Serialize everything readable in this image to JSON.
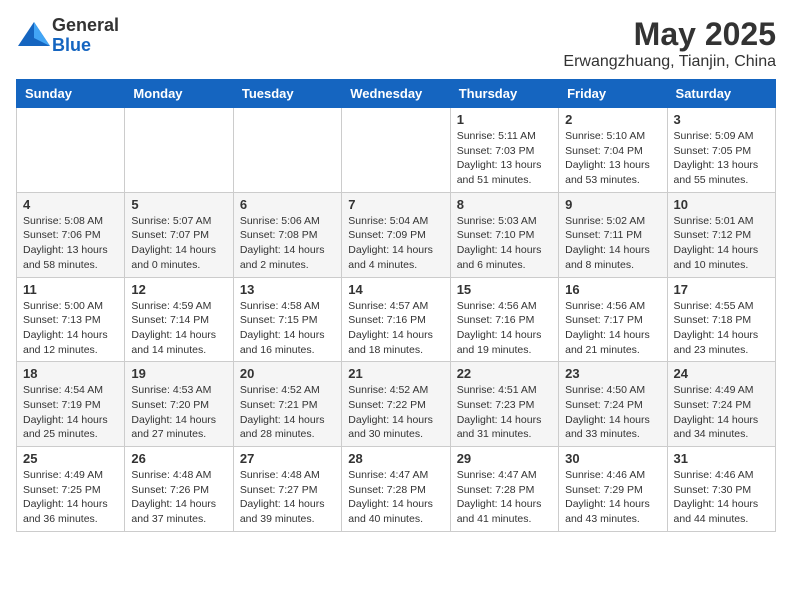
{
  "logo": {
    "general": "General",
    "blue": "Blue"
  },
  "title": "May 2025",
  "location": "Erwangzhuang, Tianjin, China",
  "headers": [
    "Sunday",
    "Monday",
    "Tuesday",
    "Wednesday",
    "Thursday",
    "Friday",
    "Saturday"
  ],
  "weeks": [
    [
      {
        "day": "",
        "info": ""
      },
      {
        "day": "",
        "info": ""
      },
      {
        "day": "",
        "info": ""
      },
      {
        "day": "",
        "info": ""
      },
      {
        "day": "1",
        "info": "Sunrise: 5:11 AM\nSunset: 7:03 PM\nDaylight: 13 hours\nand 51 minutes."
      },
      {
        "day": "2",
        "info": "Sunrise: 5:10 AM\nSunset: 7:04 PM\nDaylight: 13 hours\nand 53 minutes."
      },
      {
        "day": "3",
        "info": "Sunrise: 5:09 AM\nSunset: 7:05 PM\nDaylight: 13 hours\nand 55 minutes."
      }
    ],
    [
      {
        "day": "4",
        "info": "Sunrise: 5:08 AM\nSunset: 7:06 PM\nDaylight: 13 hours\nand 58 minutes."
      },
      {
        "day": "5",
        "info": "Sunrise: 5:07 AM\nSunset: 7:07 PM\nDaylight: 14 hours\nand 0 minutes."
      },
      {
        "day": "6",
        "info": "Sunrise: 5:06 AM\nSunset: 7:08 PM\nDaylight: 14 hours\nand 2 minutes."
      },
      {
        "day": "7",
        "info": "Sunrise: 5:04 AM\nSunset: 7:09 PM\nDaylight: 14 hours\nand 4 minutes."
      },
      {
        "day": "8",
        "info": "Sunrise: 5:03 AM\nSunset: 7:10 PM\nDaylight: 14 hours\nand 6 minutes."
      },
      {
        "day": "9",
        "info": "Sunrise: 5:02 AM\nSunset: 7:11 PM\nDaylight: 14 hours\nand 8 minutes."
      },
      {
        "day": "10",
        "info": "Sunrise: 5:01 AM\nSunset: 7:12 PM\nDaylight: 14 hours\nand 10 minutes."
      }
    ],
    [
      {
        "day": "11",
        "info": "Sunrise: 5:00 AM\nSunset: 7:13 PM\nDaylight: 14 hours\nand 12 minutes."
      },
      {
        "day": "12",
        "info": "Sunrise: 4:59 AM\nSunset: 7:14 PM\nDaylight: 14 hours\nand 14 minutes."
      },
      {
        "day": "13",
        "info": "Sunrise: 4:58 AM\nSunset: 7:15 PM\nDaylight: 14 hours\nand 16 minutes."
      },
      {
        "day": "14",
        "info": "Sunrise: 4:57 AM\nSunset: 7:16 PM\nDaylight: 14 hours\nand 18 minutes."
      },
      {
        "day": "15",
        "info": "Sunrise: 4:56 AM\nSunset: 7:16 PM\nDaylight: 14 hours\nand 19 minutes."
      },
      {
        "day": "16",
        "info": "Sunrise: 4:56 AM\nSunset: 7:17 PM\nDaylight: 14 hours\nand 21 minutes."
      },
      {
        "day": "17",
        "info": "Sunrise: 4:55 AM\nSunset: 7:18 PM\nDaylight: 14 hours\nand 23 minutes."
      }
    ],
    [
      {
        "day": "18",
        "info": "Sunrise: 4:54 AM\nSunset: 7:19 PM\nDaylight: 14 hours\nand 25 minutes."
      },
      {
        "day": "19",
        "info": "Sunrise: 4:53 AM\nSunset: 7:20 PM\nDaylight: 14 hours\nand 27 minutes."
      },
      {
        "day": "20",
        "info": "Sunrise: 4:52 AM\nSunset: 7:21 PM\nDaylight: 14 hours\nand 28 minutes."
      },
      {
        "day": "21",
        "info": "Sunrise: 4:52 AM\nSunset: 7:22 PM\nDaylight: 14 hours\nand 30 minutes."
      },
      {
        "day": "22",
        "info": "Sunrise: 4:51 AM\nSunset: 7:23 PM\nDaylight: 14 hours\nand 31 minutes."
      },
      {
        "day": "23",
        "info": "Sunrise: 4:50 AM\nSunset: 7:24 PM\nDaylight: 14 hours\nand 33 minutes."
      },
      {
        "day": "24",
        "info": "Sunrise: 4:49 AM\nSunset: 7:24 PM\nDaylight: 14 hours\nand 34 minutes."
      }
    ],
    [
      {
        "day": "25",
        "info": "Sunrise: 4:49 AM\nSunset: 7:25 PM\nDaylight: 14 hours\nand 36 minutes."
      },
      {
        "day": "26",
        "info": "Sunrise: 4:48 AM\nSunset: 7:26 PM\nDaylight: 14 hours\nand 37 minutes."
      },
      {
        "day": "27",
        "info": "Sunrise: 4:48 AM\nSunset: 7:27 PM\nDaylight: 14 hours\nand 39 minutes."
      },
      {
        "day": "28",
        "info": "Sunrise: 4:47 AM\nSunset: 7:28 PM\nDaylight: 14 hours\nand 40 minutes."
      },
      {
        "day": "29",
        "info": "Sunrise: 4:47 AM\nSunset: 7:28 PM\nDaylight: 14 hours\nand 41 minutes."
      },
      {
        "day": "30",
        "info": "Sunrise: 4:46 AM\nSunset: 7:29 PM\nDaylight: 14 hours\nand 43 minutes."
      },
      {
        "day": "31",
        "info": "Sunrise: 4:46 AM\nSunset: 7:30 PM\nDaylight: 14 hours\nand 44 minutes."
      }
    ]
  ]
}
